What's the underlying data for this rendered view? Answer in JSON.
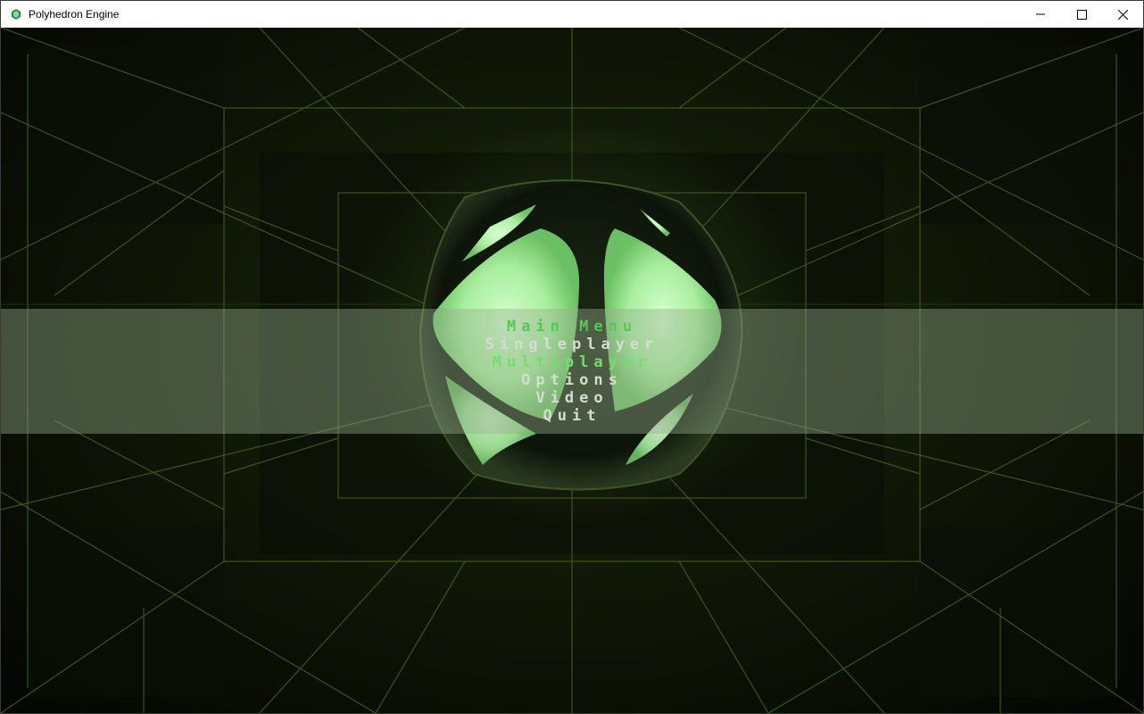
{
  "window": {
    "title": "Polyhedron Engine",
    "icon": "polyhedron-app-icon",
    "controls": [
      "minimize-icon",
      "maximize-icon",
      "close-icon"
    ]
  },
  "menu": {
    "title": "Main Menu",
    "items": [
      {
        "label": "Singleplayer",
        "state": "normal"
      },
      {
        "label": "Multiplayer",
        "state": "highlighted"
      },
      {
        "label": "Options",
        "state": "normal"
      },
      {
        "label": "Video",
        "state": "normal"
      },
      {
        "label": "Quit",
        "state": "normal"
      }
    ]
  },
  "colors": {
    "accent_green": "#6fe070",
    "title_green": "#56c85a",
    "menu_text": "#d6dcd3",
    "band": "#96af8c",
    "grid_line": "#4d6a22",
    "glow": "#b8f5b0"
  }
}
